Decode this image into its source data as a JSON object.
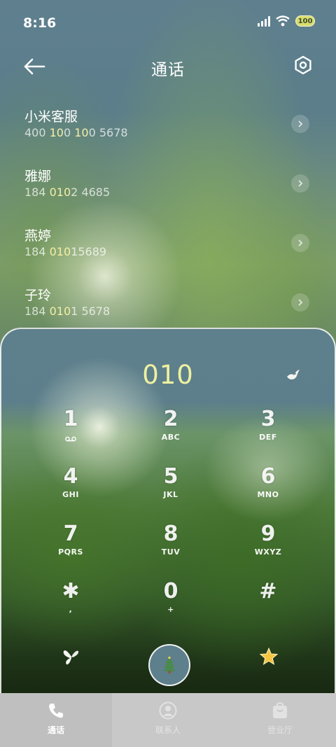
{
  "status_bar": {
    "time": "8:16",
    "battery": "100",
    "icons": [
      "signal-icon",
      "wifi-icon",
      "battery-icon"
    ]
  },
  "header": {
    "title": "通话",
    "back_icon": "back-arrow-icon",
    "settings_icon": "settings-hexagon-icon"
  },
  "contacts": [
    {
      "name": "小米客服",
      "number_parts": [
        "400 ",
        "10",
        "0 ",
        "10",
        "0 5678"
      ]
    },
    {
      "name": "雅娜",
      "number_parts": [
        "184 ",
        "010",
        "2 4685"
      ]
    },
    {
      "name": "燕婷",
      "number_parts": [
        "184 ",
        "010",
        "15689"
      ]
    },
    {
      "name": "子玲",
      "number_parts": [
        "184 ",
        "010",
        "1 5678"
      ]
    }
  ],
  "dialer": {
    "display": "010",
    "keys": [
      {
        "digit": "1",
        "letters": ""
      },
      {
        "digit": "2",
        "letters": "ABC"
      },
      {
        "digit": "3",
        "letters": "DEF"
      },
      {
        "digit": "4",
        "letters": "GHI"
      },
      {
        "digit": "5",
        "letters": "JKL"
      },
      {
        "digit": "6",
        "letters": "MNO"
      },
      {
        "digit": "7",
        "letters": "PQRS"
      },
      {
        "digit": "8",
        "letters": "TUV"
      },
      {
        "digit": "9",
        "letters": "WXYZ"
      },
      {
        "digit": "✱",
        "letters": ","
      },
      {
        "digit": "0",
        "letters": "+"
      },
      {
        "digit": "#",
        "letters": ""
      }
    ]
  },
  "bottom_nav": {
    "items": [
      {
        "label": "通话",
        "icon": "phone-icon",
        "active": true
      },
      {
        "label": "联系人",
        "icon": "contact-icon",
        "active": false
      },
      {
        "label": "营业厅",
        "icon": "store-bag-icon",
        "active": false
      }
    ]
  },
  "colors": {
    "accent_number": "#eef1a0",
    "nav_bg": "#c8c8c8",
    "panel_blue": "#5e7f8c"
  }
}
